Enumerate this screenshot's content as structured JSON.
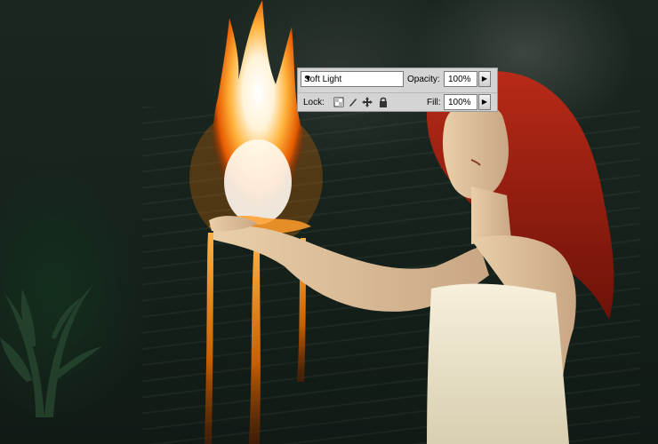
{
  "layers_panel": {
    "blend_mode": "Soft Light",
    "opacity_label": "Opacity:",
    "opacity_value": "100%",
    "lock_label": "Lock:",
    "fill_label": "Fill:",
    "fill_value": "100%"
  },
  "icons": {
    "blend_chevron": "chevron-down-icon",
    "opacity_arrow": "play-right-icon",
    "fill_arrow": "play-right-icon",
    "lock_transparent": "lock-transparent-pixels-icon",
    "lock_image": "brush-icon",
    "lock_position": "move-icon",
    "lock_all": "padlock-icon"
  },
  "colors": {
    "panel_bg": "#d4d4d4",
    "fire_core": "#fff6e6",
    "fire_orange": "#ff8a00",
    "hair_red": "#8e1a10",
    "dress": "#efe8d0",
    "background": "#17231d"
  }
}
